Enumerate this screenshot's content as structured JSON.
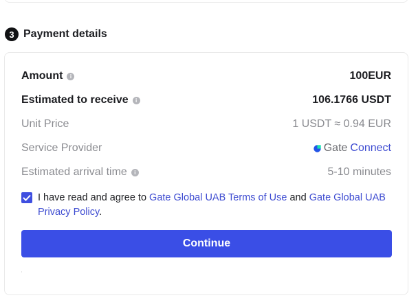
{
  "step": {
    "number": "3",
    "title": "Payment details"
  },
  "details": {
    "amount": {
      "label": "Amount",
      "value": "100EUR"
    },
    "estimated_receive": {
      "label": "Estimated to receive",
      "value": "106.1766 USDT"
    },
    "unit_price": {
      "label": "Unit Price",
      "value": "1 USDT ≈ 0.94 EUR"
    },
    "service_provider": {
      "label": "Service Provider",
      "value_brand": "Gate",
      "value_product": "Connect"
    },
    "arrival_time": {
      "label": "Estimated arrival time",
      "value": "5-10 minutes"
    }
  },
  "agreement": {
    "checked": true,
    "text_prefix": "I have read and agree to ",
    "terms_link": "Gate Global UAB Terms of Use",
    "text_middle": " and ",
    "privacy_link": "Gate Global UAB Privacy Policy",
    "text_suffix": "."
  },
  "continue_label": "Continue",
  "colors": {
    "accent": "#3a4ee6",
    "link": "#3d4bd1",
    "muted_text": "#8a8b90",
    "strong_text": "#1c1d21"
  }
}
